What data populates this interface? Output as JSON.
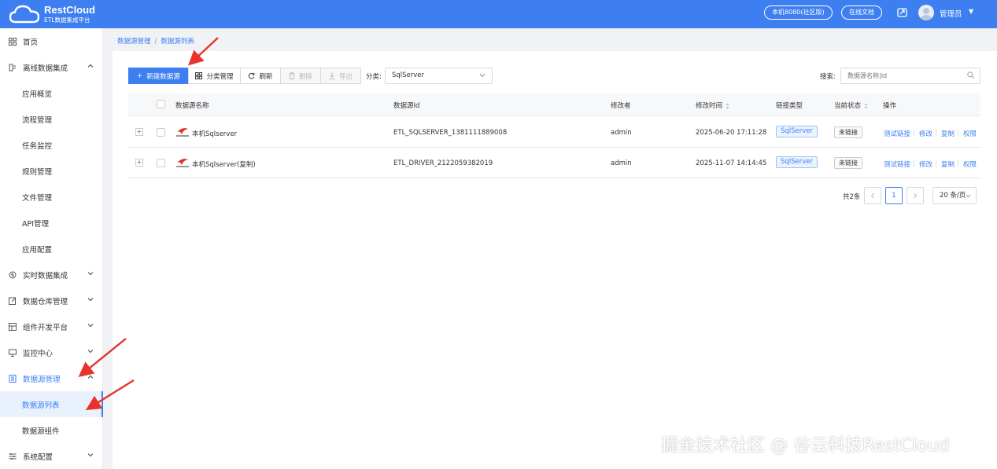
{
  "header": {
    "logo_title": "RestCloud",
    "logo_subtitle": "ETL数据集成平台",
    "instance_button": "本机8080(社区版)",
    "docs_button": "在线文档",
    "user_name": "管理员",
    "brand_color": "#3d7ff0"
  },
  "sidebar": {
    "home": "首页",
    "offline": {
      "label": "离线数据集成",
      "children": [
        "应用概览",
        "流程管理",
        "任务监控",
        "规则管理",
        "文件管理",
        "API管理",
        "应用配置"
      ]
    },
    "realtime": "实时数据集成",
    "warehouse": "数据仓库管理",
    "devplatform": "组件开发平台",
    "monitor": "监控中心",
    "datasource": {
      "label": "数据源管理",
      "children": [
        "数据源列表",
        "数据源组件"
      ]
    },
    "system": "系统配置"
  },
  "breadcrumb": [
    "数据源管理",
    "数据源列表"
  ],
  "toolbar": {
    "new": "新建数据源",
    "category_manage": "分类管理",
    "refresh": "刷新",
    "delete": "删除",
    "export": "导出",
    "category_label": "分类:",
    "category_value": "SqlServer",
    "search_label": "搜索:",
    "search_placeholder": "数据源名称|Id"
  },
  "table": {
    "columns": {
      "name": "数据源名称",
      "id": "数据源Id",
      "modifier": "修改者",
      "modified_time": "修改时间",
      "link_type": "链接类型",
      "status": "当前状态",
      "actions": "操作"
    },
    "action_labels": [
      "测试链接",
      "修改",
      "复制",
      "权限"
    ],
    "rows": [
      {
        "name": "本机Sqlserver",
        "id": "ETL_SQLSERVER_1381111889008",
        "modifier": "admin",
        "modified_time": "2025-06-20 17:11:28",
        "link_type": "SqlServer",
        "status": "未链接"
      },
      {
        "name": "本机Sqlserver(复制)",
        "id": "ETL_DRIVER_2122059382019",
        "modifier": "admin",
        "modified_time": "2025-11-07 14:14:45",
        "link_type": "SqlServer",
        "status": "未链接"
      }
    ]
  },
  "pagination": {
    "total": "共2条",
    "current_page": "1",
    "page_size": "20 条/页"
  },
  "watermark": "掘金技术社区 @ 谷云科技RestCloud"
}
